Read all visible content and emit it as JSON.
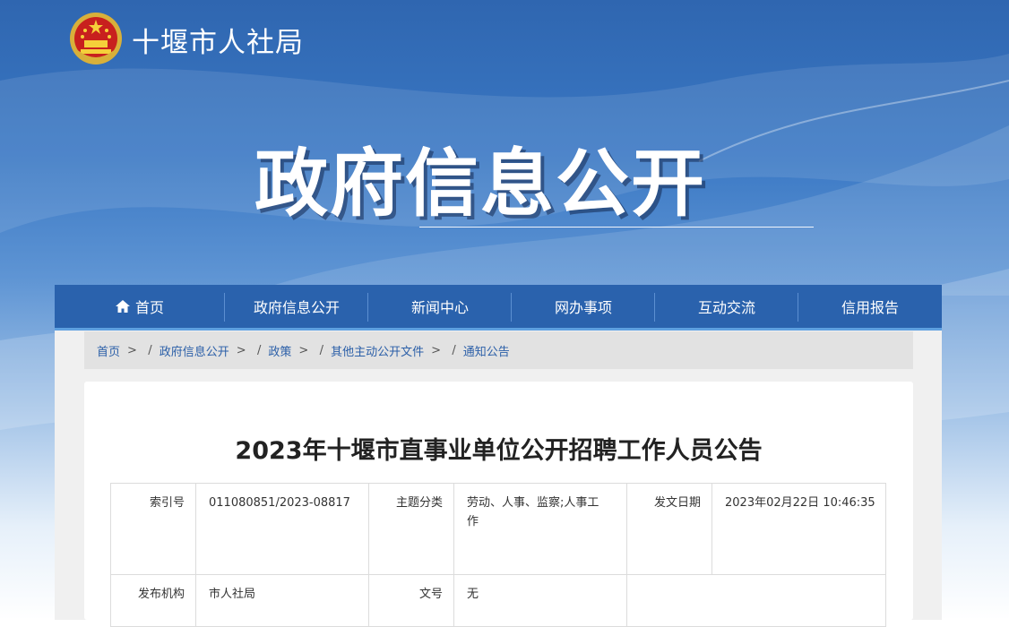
{
  "header": {
    "site_name": "十堰市人社局",
    "section_title": "政府信息公开",
    "colors": {
      "banner_top": "#2f66b0",
      "nav_bg": "#2a62ad",
      "link": "#2b5fa8"
    }
  },
  "nav": {
    "items": [
      {
        "label": "首页",
        "icon": "home-icon"
      },
      {
        "label": "政府信息公开"
      },
      {
        "label": "新闻中心"
      },
      {
        "label": "网办事项"
      },
      {
        "label": "互动交流"
      },
      {
        "label": "信用报告"
      }
    ]
  },
  "breadcrumb": {
    "items": [
      "首页",
      "政府信息公开",
      "政策",
      "其他主动公开文件",
      "通知公告"
    ],
    "sep_before": ">",
    "sep_after": "/"
  },
  "article": {
    "title": "2023年十堰市直事业单位公开招聘工作人员公告",
    "meta": {
      "index_label": "索引号",
      "index_value": "011080851/2023-08817",
      "topic_label": "主题分类",
      "topic_value_1": "劳动、人事、监察;人事工",
      "topic_value_2": "作",
      "date_label": "发文日期",
      "date_value": "2023年02月22日 10:46:35",
      "issuer_label": "发布机构",
      "issuer_value": "市人社局",
      "docno_label": "文号",
      "docno_value": "无"
    }
  }
}
